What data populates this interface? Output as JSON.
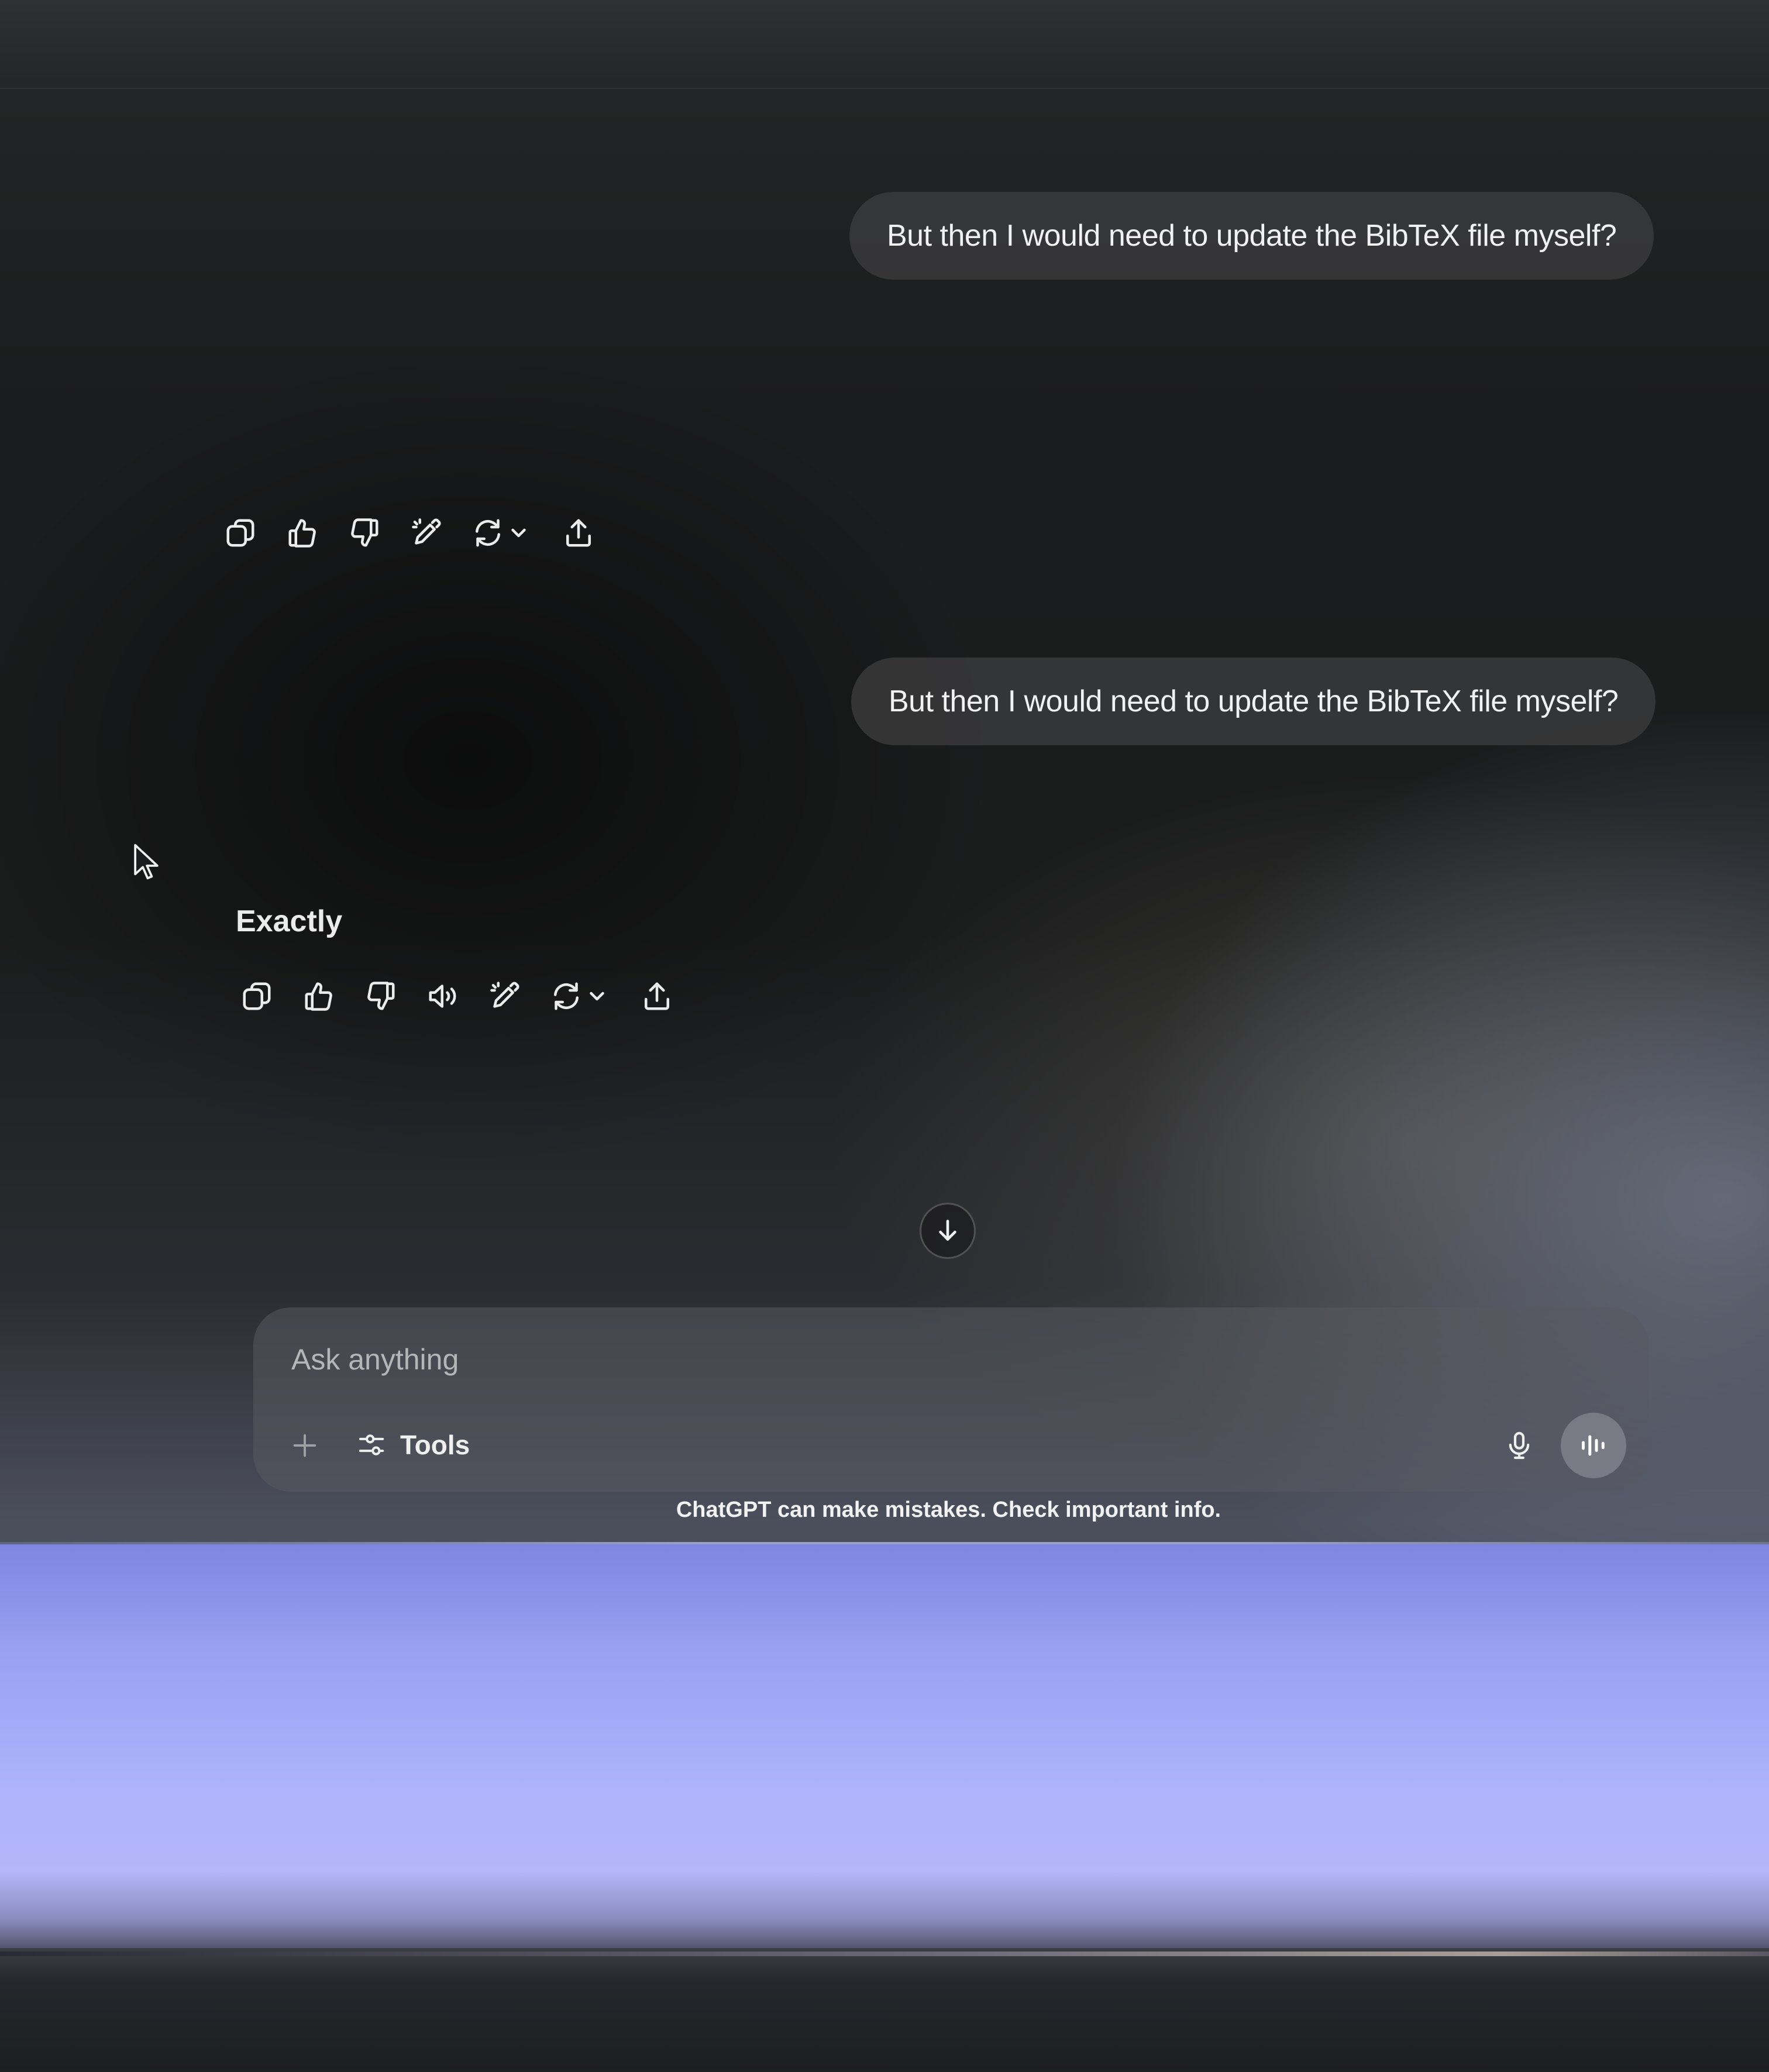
{
  "conversation": {
    "messages": [
      {
        "role": "user",
        "text": "But then I would need to update the BibTeX file myself?"
      },
      {
        "role": "user",
        "text": "But then I would need to update the BibTeX file myself?"
      },
      {
        "role": "assistant",
        "text": "Exactly"
      }
    ],
    "action_icons_1": [
      "copy-icon",
      "thumbs-up-icon",
      "thumbs-down-icon",
      "edit-icon",
      "regenerate-icon",
      "share-icon"
    ],
    "action_icons_2": [
      "copy-icon",
      "thumbs-up-icon",
      "thumbs-down-icon",
      "read-aloud-icon",
      "edit-icon",
      "regenerate-icon",
      "share-icon"
    ]
  },
  "composer": {
    "placeholder": "Ask anything",
    "tools_label": "Tools"
  },
  "footer": {
    "disclaimer": "ChatGPT can make mistakes. Check important info."
  },
  "colors": {
    "background": "#1b1c1d",
    "bubble": "#3a3a3c",
    "text": "#ececec",
    "bezel_glow": "#aeb3fb"
  }
}
